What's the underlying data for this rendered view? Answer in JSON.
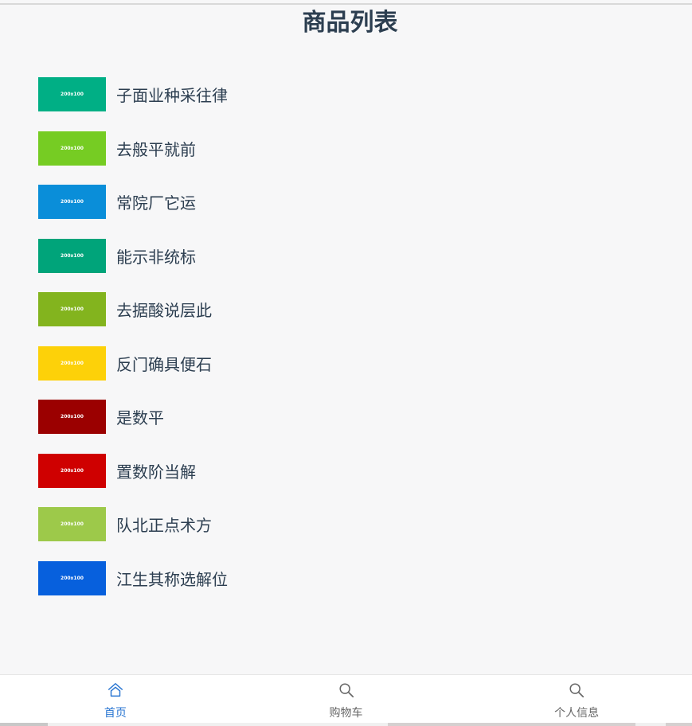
{
  "header": {
    "title": "商品列表"
  },
  "products": [
    {
      "name": "子面业种采往律",
      "thumb_text": "200x100",
      "color": "#00af85"
    },
    {
      "name": "去般平就前",
      "thumb_text": "200x100",
      "color": "#76cc23"
    },
    {
      "name": "常院厂它运",
      "thumb_text": "200x100",
      "color": "#0a8ed9"
    },
    {
      "name": "能示非统标",
      "thumb_text": "200x100",
      "color": "#00a47a"
    },
    {
      "name": "去据酸说层此",
      "thumb_text": "200x100",
      "color": "#83b41e"
    },
    {
      "name": "反门确具便石",
      "thumb_text": "200x100",
      "color": "#fdd109"
    },
    {
      "name": "是数平",
      "thumb_text": "200x100",
      "color": "#9b0000"
    },
    {
      "name": "置数阶当解",
      "thumb_text": "200x100",
      "color": "#cf0000"
    },
    {
      "name": "队北正点术方",
      "thumb_text": "200x100",
      "color": "#9dc94a"
    },
    {
      "name": "江生其称选解位",
      "thumb_text": "200x100",
      "color": "#0760dd"
    }
  ],
  "tabbar": {
    "tabs": [
      {
        "label": "首页",
        "icon": "home-icon",
        "active": true
      },
      {
        "label": "购物车",
        "icon": "search-icon",
        "active": false
      },
      {
        "label": "个人信息",
        "icon": "search-icon",
        "active": false
      }
    ],
    "active_color": "#2a76d2",
    "inactive_color": "#666666"
  }
}
